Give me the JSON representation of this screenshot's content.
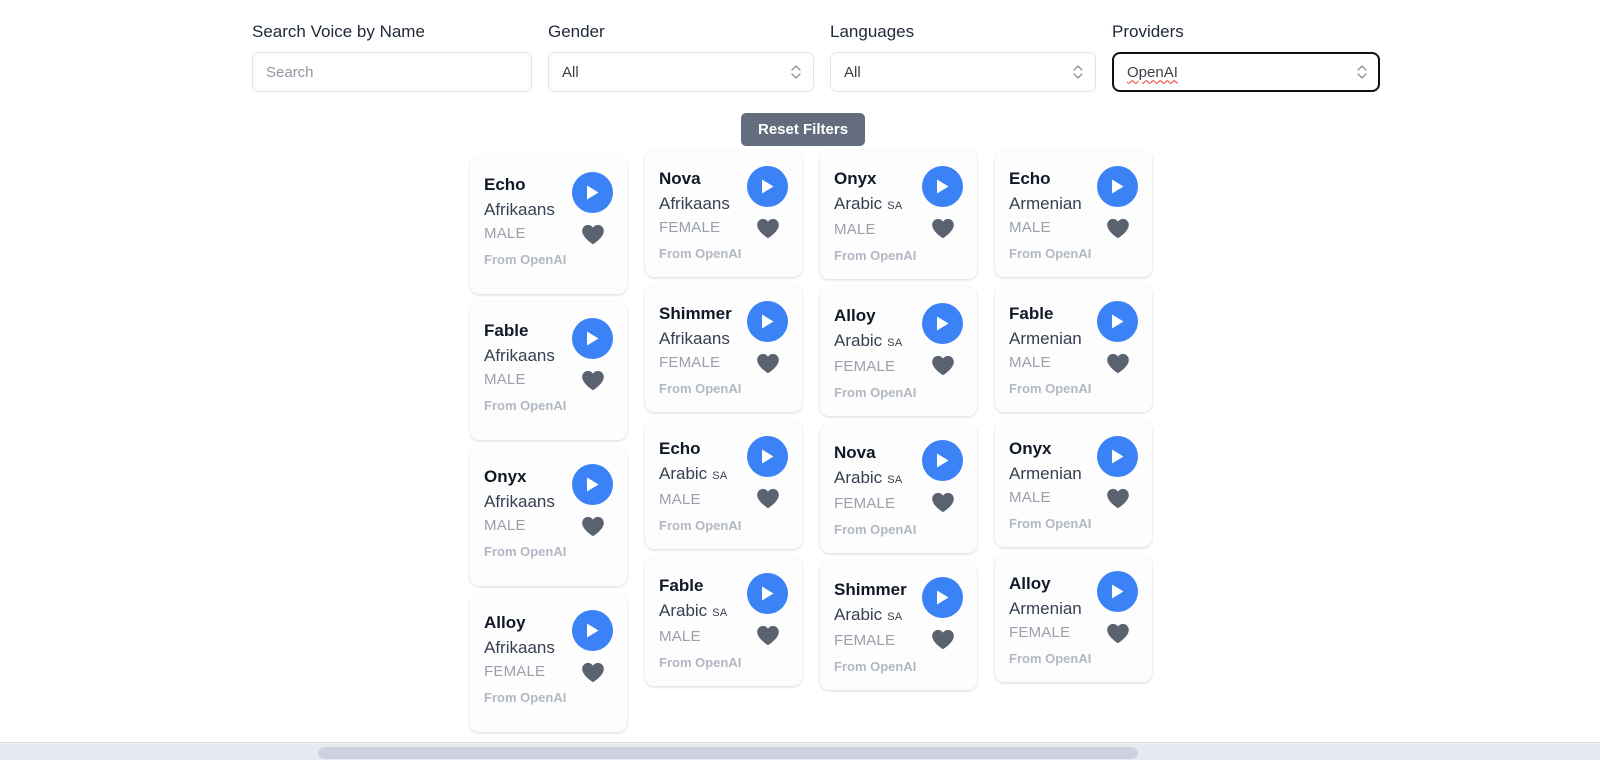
{
  "filters": {
    "search": {
      "label": "Search Voice by Name",
      "placeholder": "Search",
      "value": ""
    },
    "gender": {
      "label": "Gender",
      "value": "All"
    },
    "languages": {
      "label": "Languages",
      "value": "All"
    },
    "providers": {
      "label": "Providers",
      "value": "OpenAI",
      "focused": true,
      "spellcheck_flagged": true
    },
    "reset_button": "Reset Filters"
  },
  "icons": {
    "play": "play-icon",
    "favorite": "heart-icon",
    "select_arrows": "chevron-updown-icon"
  },
  "colors": {
    "accent_blue": "#3b82f6",
    "heart_gray": "#5a6270",
    "reset_button_bg": "#646d7d",
    "focus_border": "#111111",
    "spellcheck_red": "#e8342a",
    "label_text": "#1f2937",
    "card_bg": "#fdfdfe",
    "page_bg": "#ffffff"
  },
  "columns": [
    {
      "cards": [
        {
          "name": "Echo",
          "language": "Afrikaans",
          "region": "",
          "gender": "MALE",
          "provider": "From OpenAI"
        },
        {
          "name": "Fable",
          "language": "Afrikaans",
          "region": "",
          "gender": "MALE",
          "provider": "From OpenAI"
        },
        {
          "name": "Onyx",
          "language": "Afrikaans",
          "region": "",
          "gender": "MALE",
          "provider": "From OpenAI"
        },
        {
          "name": "Alloy",
          "language": "Afrikaans",
          "region": "",
          "gender": "FEMALE",
          "provider": "From OpenAI"
        }
      ]
    },
    {
      "cards": [
        {
          "name": "Nova",
          "language": "Afrikaans",
          "region": "",
          "gender": "FEMALE",
          "provider": "From OpenAI"
        },
        {
          "name": "Shimmer",
          "language": "Afrikaans",
          "region": "",
          "gender": "FEMALE",
          "provider": "From OpenAI"
        },
        {
          "name": "Echo",
          "language": "Arabic",
          "region": "SA",
          "gender": "MALE",
          "provider": "From OpenAI"
        },
        {
          "name": "Fable",
          "language": "Arabic",
          "region": "SA",
          "gender": "MALE",
          "provider": "From OpenAI"
        }
      ]
    },
    {
      "cards": [
        {
          "name": "Onyx",
          "language": "Arabic",
          "region": "SA",
          "gender": "MALE",
          "provider": "From OpenAI"
        },
        {
          "name": "Alloy",
          "language": "Arabic",
          "region": "SA",
          "gender": "FEMALE",
          "provider": "From OpenAI"
        },
        {
          "name": "Nova",
          "language": "Arabic",
          "region": "SA",
          "gender": "FEMALE",
          "provider": "From OpenAI"
        },
        {
          "name": "Shimmer",
          "language": "Arabic",
          "region": "SA",
          "gender": "FEMALE",
          "provider": "From OpenAI"
        }
      ]
    },
    {
      "cards": [
        {
          "name": "Echo",
          "language": "Armenian",
          "region": "",
          "gender": "MALE",
          "provider": "From OpenAI"
        },
        {
          "name": "Fable",
          "language": "Armenian",
          "region": "",
          "gender": "MALE",
          "provider": "From OpenAI"
        },
        {
          "name": "Onyx",
          "language": "Armenian",
          "region": "",
          "gender": "MALE",
          "provider": "From OpenAI"
        },
        {
          "name": "Alloy",
          "language": "Armenian",
          "region": "",
          "gender": "FEMALE",
          "provider": "From OpenAI"
        }
      ]
    }
  ]
}
